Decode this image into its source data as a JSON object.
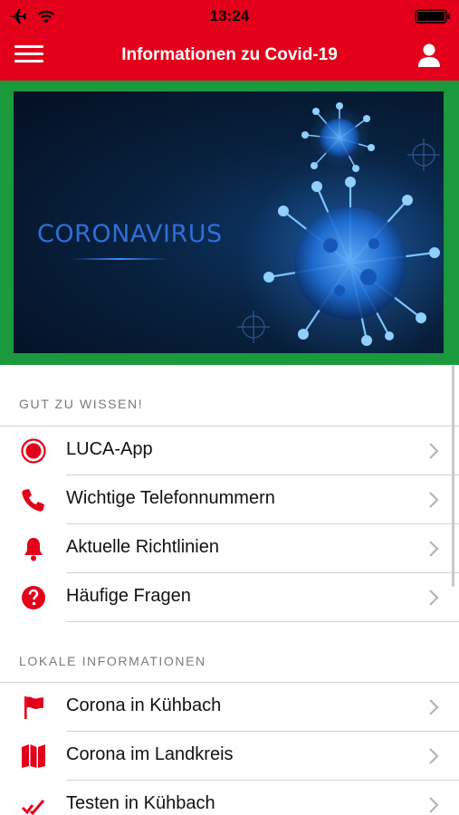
{
  "status_bar": {
    "time": "13:24"
  },
  "nav": {
    "title": "Informationen zu Covid-19"
  },
  "hero": {
    "text": "CORONAVIRUS"
  },
  "sections": [
    {
      "header": "GUT ZU WISSEN!",
      "items": [
        {
          "label": "LUCA-App",
          "icon": "record-icon"
        },
        {
          "label": "Wichtige Telefonnummern",
          "icon": "phone-icon"
        },
        {
          "label": "Aktuelle Richtlinien",
          "icon": "bell-icon"
        },
        {
          "label": "Häufige Fragen",
          "icon": "question-icon"
        }
      ]
    },
    {
      "header": "LOKALE INFORMATIONEN",
      "items": [
        {
          "label": "Corona in Kühbach",
          "icon": "flag-icon"
        },
        {
          "label": "Corona im Landkreis",
          "icon": "map-icon"
        },
        {
          "label": "Testen in Kühbach",
          "icon": "check-icon"
        }
      ]
    }
  ],
  "colors": {
    "accent": "#e3001b",
    "hero_border": "#1a9a3c",
    "hero_text": "#2f6fd8"
  }
}
